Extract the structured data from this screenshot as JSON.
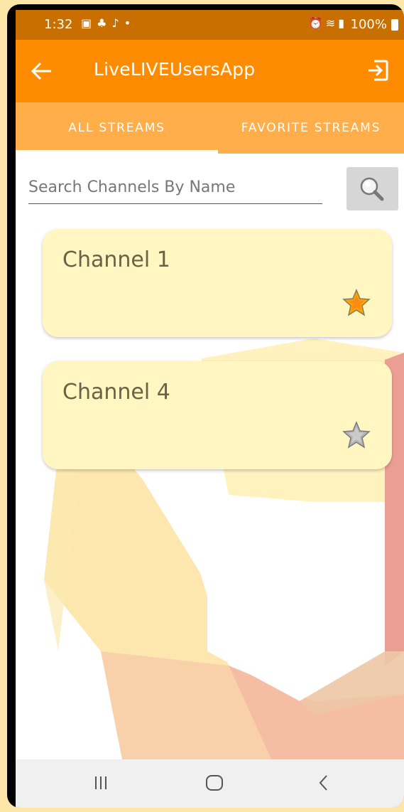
{
  "status_bar": {
    "time": "1:32",
    "left_icons": [
      "image-icon",
      "notification-icon",
      "music-icon",
      "dot-icon"
    ],
    "right_icons": [
      "alarm-icon",
      "wifi-icon",
      "signal-icon"
    ],
    "battery": "100%"
  },
  "app_bar": {
    "title": "LiveLIVEUsersApp",
    "back_icon": "arrow-left-icon",
    "logout_icon": "logout-icon"
  },
  "tabs": [
    {
      "label": "ALL STREAMS",
      "selected": true
    },
    {
      "label": "FAVORITE STREAMS",
      "selected": false
    }
  ],
  "search": {
    "placeholder": "Search Channels By Name",
    "value": "",
    "button_icon": "magnifier-icon"
  },
  "channels": [
    {
      "name": "Channel 1",
      "favorite": true
    },
    {
      "name": "Channel 4",
      "favorite": false
    }
  ],
  "nav_bar": {
    "icons": [
      "recents-icon",
      "home-icon",
      "back-icon"
    ]
  },
  "colors": {
    "status_bar": "#c96f00",
    "app_bar": "#ff8c00",
    "tabs": "#ffae4a",
    "card": "#fff6c2",
    "star_active": "#ffa500",
    "star_inactive": "#a8a8a8"
  }
}
